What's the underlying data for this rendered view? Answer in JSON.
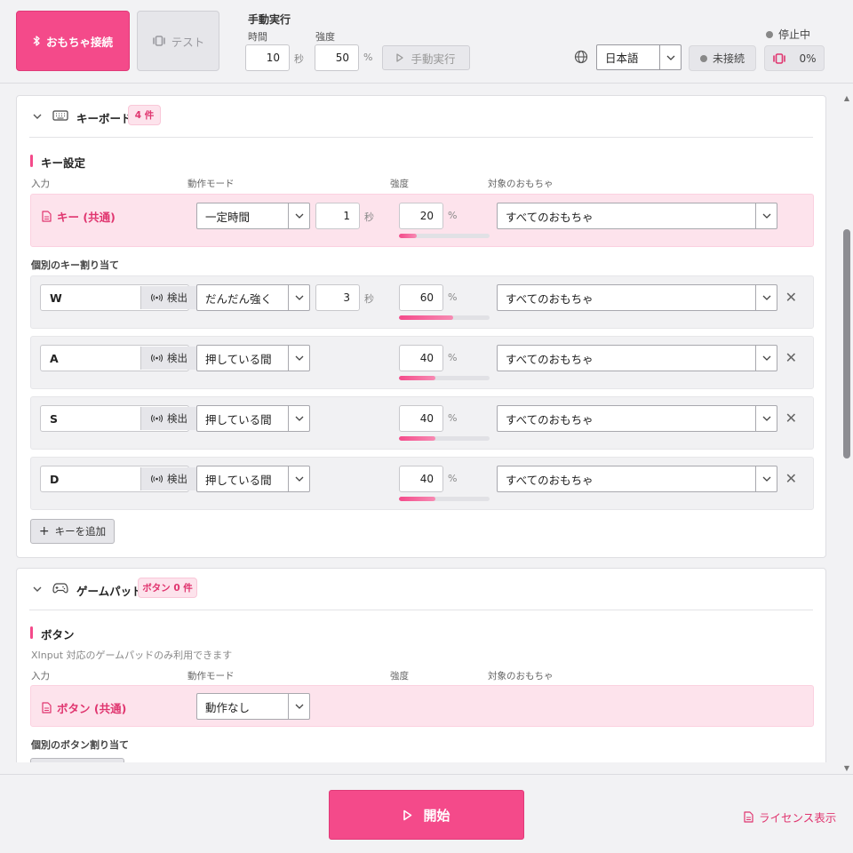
{
  "header": {
    "connect_label": "おもちゃ接続",
    "test_label": "テスト",
    "manual_title": "手動実行",
    "time_label": "時間",
    "time_value": "10",
    "time_unit": "秒",
    "strength_label": "強度",
    "strength_value": "50",
    "strength_unit": "%",
    "manual_button": "手動実行",
    "language": "日本語",
    "connection_status": "未接続",
    "run_status": "停止中",
    "vibration_level": "0%"
  },
  "keyboard": {
    "title": "キーボード",
    "badge": "4 件",
    "section_title": "キー設定",
    "columns": {
      "input": "入力",
      "mode": "動作モード",
      "strength": "強度",
      "target": "対象のおもちゃ"
    },
    "common": {
      "label": "キー (共通)",
      "mode": "一定時間",
      "duration": "1",
      "duration_unit": "秒",
      "strength": "20",
      "strength_unit": "%",
      "strength_fraction": 0.2,
      "target": "すべてのおもちゃ"
    },
    "individual_title": "個別のキー割り当て",
    "detect_label": "検出",
    "rows": [
      {
        "key": "W",
        "mode": "だんだん強く",
        "duration": "3",
        "duration_unit": "秒",
        "strength": "60",
        "strength_unit": "%",
        "strength_fraction": 0.6,
        "target": "すべてのおもちゃ"
      },
      {
        "key": "A",
        "mode": "押している間",
        "strength": "40",
        "strength_unit": "%",
        "strength_fraction": 0.4,
        "target": "すべてのおもちゃ"
      },
      {
        "key": "S",
        "mode": "押している間",
        "strength": "40",
        "strength_unit": "%",
        "strength_fraction": 0.4,
        "target": "すべてのおもちゃ"
      },
      {
        "key": "D",
        "mode": "押している間",
        "strength": "40",
        "strength_unit": "%",
        "strength_fraction": 0.4,
        "target": "すべてのおもちゃ"
      }
    ],
    "add_label": "キーを追加"
  },
  "gamepad": {
    "title": "ゲームパッド",
    "badge": "ボタン 0 件",
    "section_title": "ボタン",
    "note": "XInput 対応のゲームパッドのみ利用できます",
    "columns": {
      "input": "入力",
      "mode": "動作モード",
      "strength": "強度",
      "target": "対象のおもちゃ"
    },
    "common": {
      "label": "ボタン (共通)",
      "mode": "動作なし"
    },
    "individual_title": "個別のボタン割り当て"
  },
  "footer": {
    "start_label": "開始",
    "license_label": "ライセンス表示"
  },
  "colors": {
    "accent": "#f44a8a",
    "accent_text": "#e0356f",
    "accent_light": "#fde3ec"
  }
}
